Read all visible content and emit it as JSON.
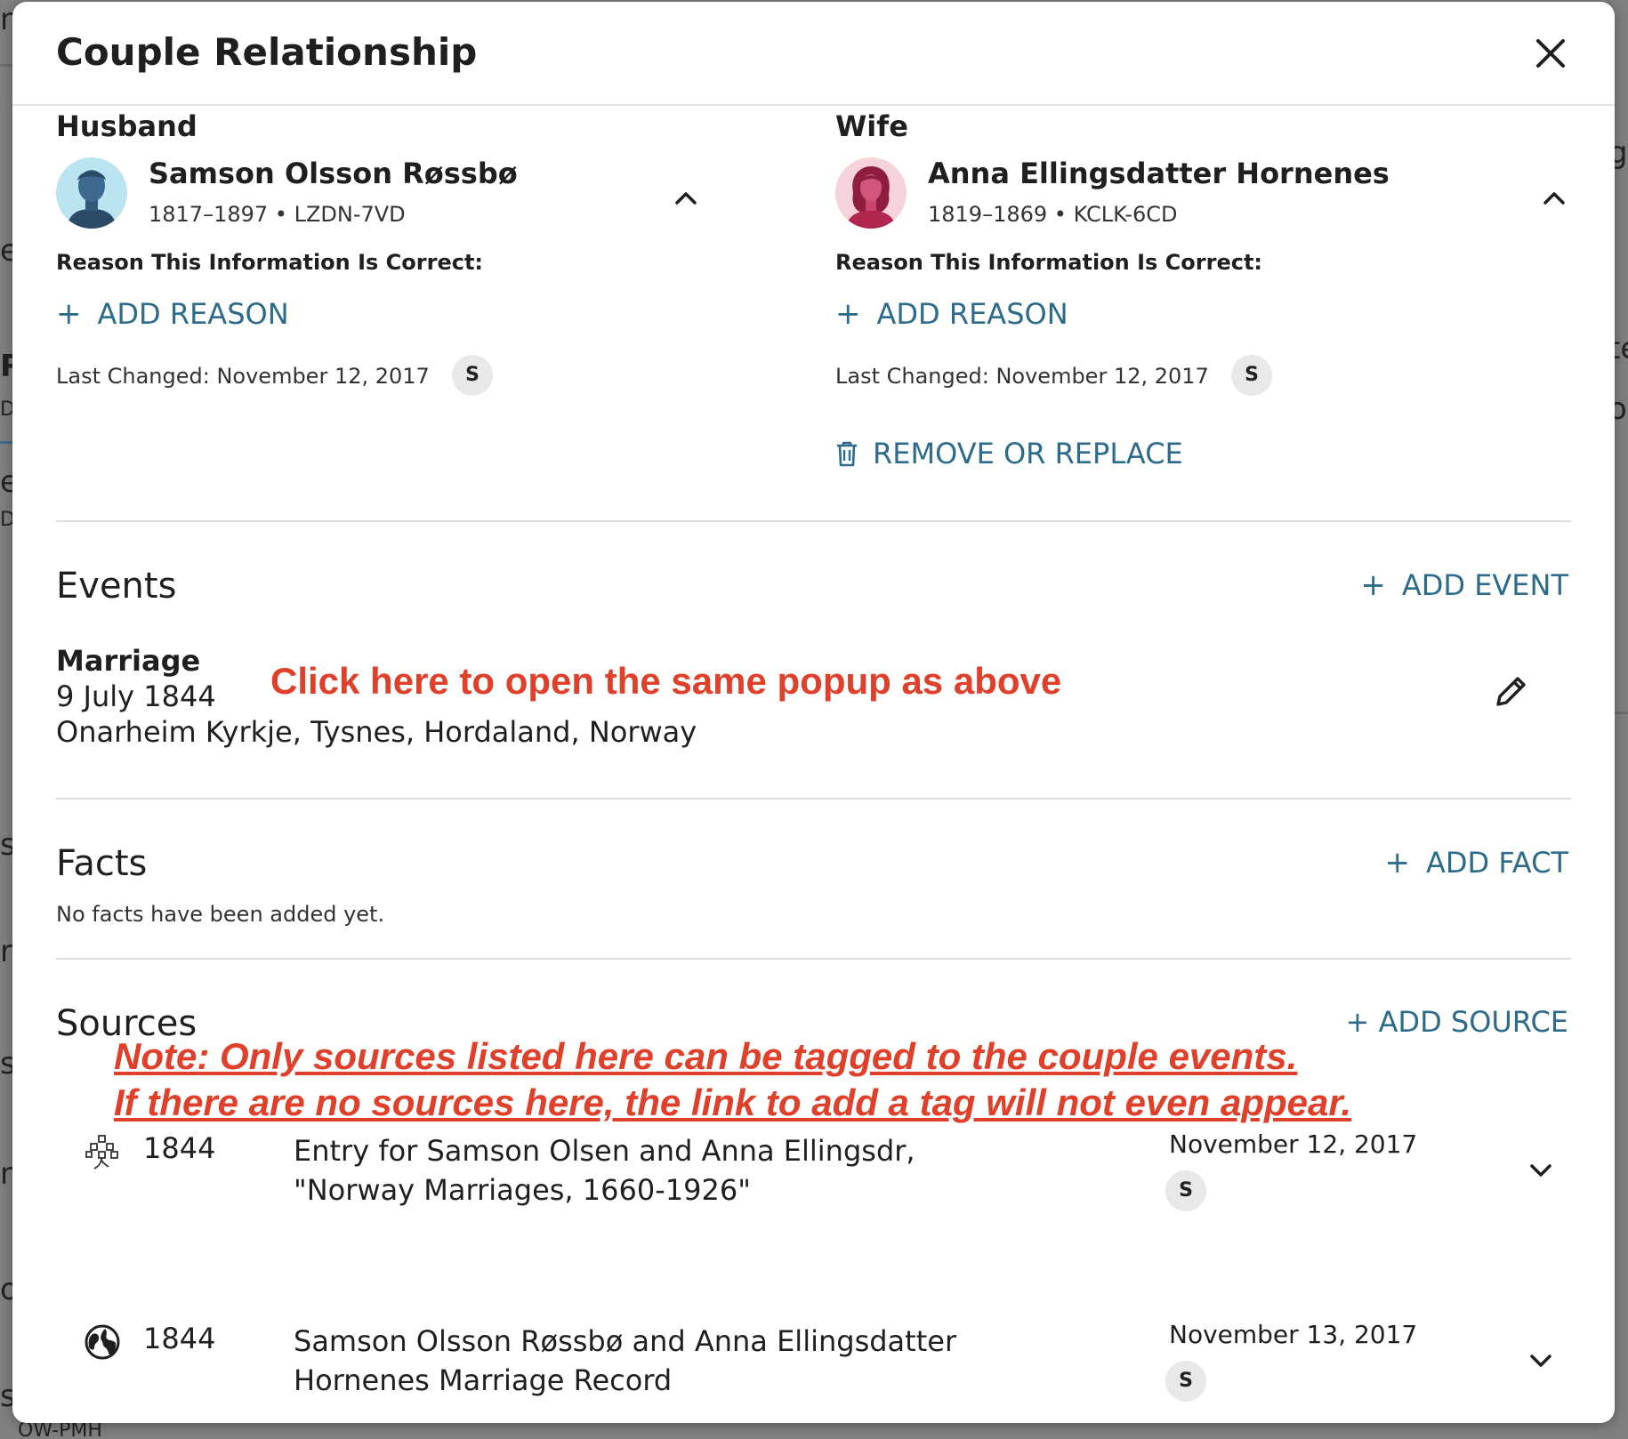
{
  "background": {
    "fragments": [
      "n",
      "e",
      "R",
      "D",
      "e",
      "D",
      "s",
      "r",
      "s",
      "n",
      "o",
      "s",
      "g",
      "te",
      "ol",
      "OW-PMH"
    ]
  },
  "modal": {
    "title": "Couple Relationship"
  },
  "husband": {
    "role": "Husband",
    "name": "Samson Olsson Røssbø",
    "meta": "1817–1897 • LZDN-7VD",
    "reason_label": "Reason This Information Is Correct:",
    "add_reason": "ADD REASON",
    "last_changed": "Last Changed: November 12, 2017",
    "badge": "S"
  },
  "wife": {
    "role": "Wife",
    "name": "Anna Ellingsdatter Hornenes",
    "meta": "1819–1869 • KCLK-6CD",
    "reason_label": "Reason This Information Is Correct:",
    "add_reason": "ADD REASON",
    "last_changed": "Last Changed: November 12, 2017",
    "badge": "S",
    "remove": "REMOVE OR REPLACE"
  },
  "events": {
    "title": "Events",
    "add": "ADD EVENT",
    "items": [
      {
        "type": "Marriage",
        "date": "9 July 1844",
        "place": "Onarheim Kyrkje, Tysnes, Hordaland, Norway"
      }
    ]
  },
  "facts": {
    "title": "Facts",
    "add": "ADD FACT",
    "empty": "No facts have been added yet."
  },
  "sources": {
    "title": "Sources",
    "add": "+ ADD SOURCE",
    "items": [
      {
        "icon": "tree-icon",
        "year": "1844",
        "title": "Entry for Samson Olsen and Anna Ellingsdr, \"Norway Marriages, 1660-1926\"",
        "date": "November 12, 2017",
        "badge": "S"
      },
      {
        "icon": "globe-icon",
        "year": "1844",
        "title": "Samson Olsson Røssbø and Anna Ellingsdatter Hornenes Marriage Record",
        "date": "November 13, 2017",
        "badge": "S"
      }
    ]
  },
  "annotations": {
    "click_here": "Click here to open the same popup as above",
    "note_line1": "Note: Only sources listed here can be tagged to the couple events.",
    "note_line2": "If there are no sources here, the link to add a tag will not even appear."
  },
  "colors": {
    "link": "#2d6b8a",
    "annotation": "#e0402a",
    "male_avatar_bg": "#b9e4f0",
    "female_avatar_bg": "#f6d3db"
  }
}
